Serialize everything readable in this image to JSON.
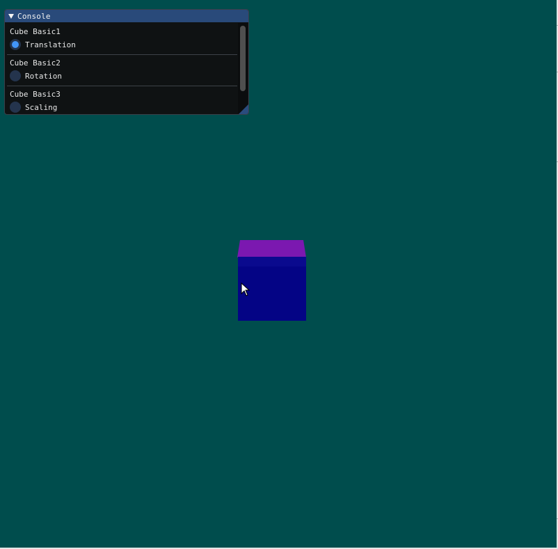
{
  "console": {
    "title": "Console",
    "groups": [
      {
        "label": "Cube Basic1",
        "option": "Translation",
        "selected": true
      },
      {
        "label": "Cube Basic2",
        "option": "Rotation",
        "selected": false
      },
      {
        "label": "Cube Basic3",
        "option": "Scaling",
        "selected": false
      }
    ]
  },
  "scene": {
    "background_color": "#004d4d",
    "cube_top_color": "#7b18b0",
    "cube_front_color": "#040485"
  },
  "icons": {
    "collapse": "triangle-down",
    "cursor": "arrow-pointer"
  }
}
